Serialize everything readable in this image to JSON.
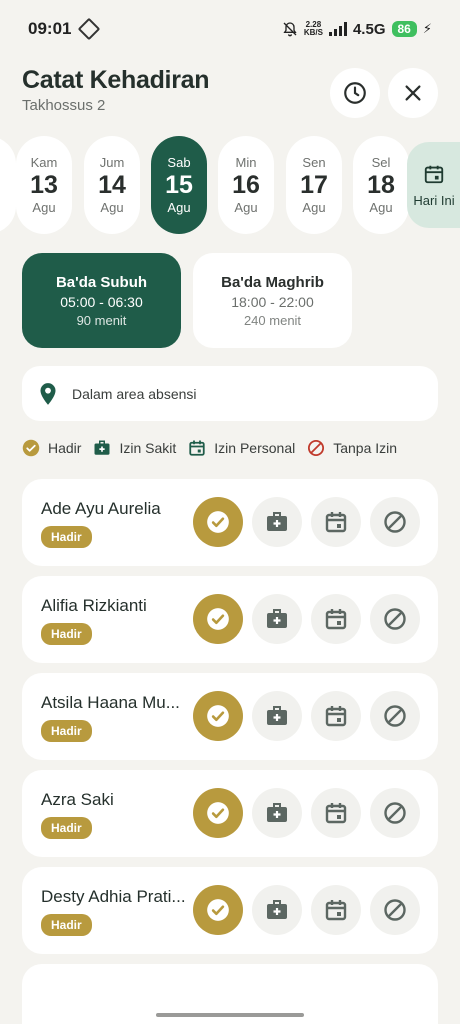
{
  "status_bar": {
    "time": "09:01",
    "speed_top": "2.28",
    "speed_bottom": "KB/S",
    "network": "4.5G",
    "battery": "86"
  },
  "header": {
    "title": "Catat Kehadiran",
    "subtitle": "Takhossus 2"
  },
  "dates": [
    {
      "day": "Kam",
      "num": "13",
      "month": "Agu"
    },
    {
      "day": "Jum",
      "num": "14",
      "month": "Agu"
    },
    {
      "day": "Sab",
      "num": "15",
      "month": "Agu",
      "selected": true
    },
    {
      "day": "Min",
      "num": "16",
      "month": "Agu"
    },
    {
      "day": "Sen",
      "num": "17",
      "month": "Agu"
    },
    {
      "day": "Sel",
      "num": "18",
      "month": "Agu"
    }
  ],
  "today_label": "Hari Ini",
  "sessions": [
    {
      "name": "Ba'da Subuh",
      "time": "05:00 - 06:30",
      "duration": "90 menit"
    },
    {
      "name": "Ba'da Maghrib",
      "time": "18:00 - 22:00",
      "duration": "240 menit"
    }
  ],
  "location": "Dalam area absensi",
  "legend": [
    "Hadir",
    "Izin Sakit",
    "Izin Personal",
    "Tanpa Izin"
  ],
  "students": [
    {
      "name": "Ade Ayu Aurelia",
      "status": "Hadir"
    },
    {
      "name": "Alifia Rizkianti",
      "status": "Hadir"
    },
    {
      "name": "Atsila Haana Mu...",
      "status": "Hadir"
    },
    {
      "name": "Azra Saki",
      "status": "Hadir"
    },
    {
      "name": "Desty Adhia Prati...",
      "status": "Hadir"
    }
  ],
  "colors": {
    "primary": "#1f5c49",
    "hadir": "#b89a3e",
    "icon_gray": "#5c6762",
    "tanpa_izin": "#c0392b"
  }
}
